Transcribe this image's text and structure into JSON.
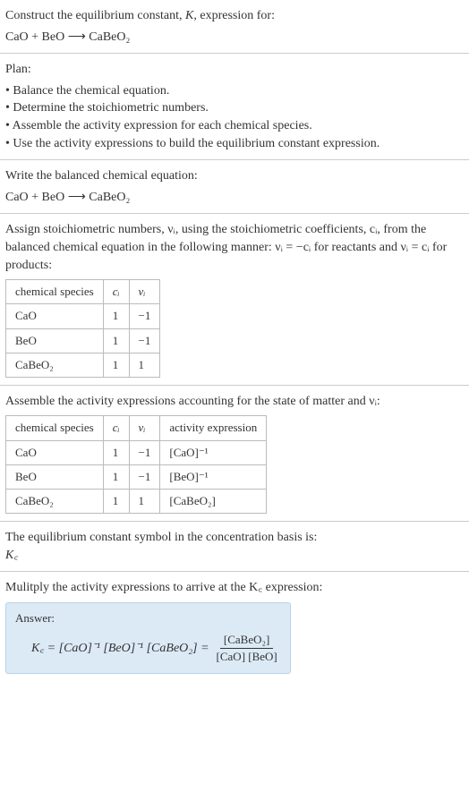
{
  "intro": {
    "line1": "Construct the equilibrium constant, K, expression for:",
    "equation": "CaO + BeO ⟶ CaBeO₂"
  },
  "plan": {
    "heading": "Plan:",
    "items": [
      "Balance the chemical equation.",
      "Determine the stoichiometric numbers.",
      "Assemble the activity expression for each chemical species.",
      "Use the activity expressions to build the equilibrium constant expression."
    ]
  },
  "balanced": {
    "heading": "Write the balanced chemical equation:",
    "equation": "CaO + BeO ⟶ CaBeO₂"
  },
  "stoich": {
    "text_a": "Assign stoichiometric numbers, νᵢ, using the stoichiometric coefficients, cᵢ, from the balanced chemical equation in the following manner: νᵢ = −cᵢ for reactants and νᵢ = cᵢ for products:",
    "headers": {
      "species": "chemical species",
      "ci": "cᵢ",
      "vi": "νᵢ"
    },
    "rows": [
      {
        "species": "CaO",
        "ci": "1",
        "vi": "−1"
      },
      {
        "species": "BeO",
        "ci": "1",
        "vi": "−1"
      },
      {
        "species": "CaBeO₂",
        "ci": "1",
        "vi": "1"
      }
    ]
  },
  "activity": {
    "heading": "Assemble the activity expressions accounting for the state of matter and νᵢ:",
    "headers": {
      "species": "chemical species",
      "ci": "cᵢ",
      "vi": "νᵢ",
      "expr": "activity expression"
    },
    "rows": [
      {
        "species": "CaO",
        "ci": "1",
        "vi": "−1",
        "expr": "[CaO]⁻¹"
      },
      {
        "species": "BeO",
        "ci": "1",
        "vi": "−1",
        "expr": "[BeO]⁻¹"
      },
      {
        "species": "CaBeO₂",
        "ci": "1",
        "vi": "1",
        "expr": "[CaBeO₂]"
      }
    ]
  },
  "symbol_note": {
    "line": "The equilibrium constant symbol in the concentration basis is:",
    "sym": "K꜀"
  },
  "multiply": {
    "line": "Mulitply the activity expressions to arrive at the K꜀ expression:"
  },
  "answer": {
    "label": "Answer:",
    "lhs": "K꜀ = [CaO]⁻¹ [BeO]⁻¹ [CaBeO₂] =",
    "frac_num": "[CaBeO₂]",
    "frac_den": "[CaO] [BeO]"
  },
  "chart_data": {
    "type": "table",
    "tables": [
      {
        "title": "Stoichiometric numbers",
        "columns": [
          "chemical species",
          "cᵢ",
          "νᵢ"
        ],
        "rows": [
          [
            "CaO",
            1,
            -1
          ],
          [
            "BeO",
            1,
            -1
          ],
          [
            "CaBeO₂",
            1,
            1
          ]
        ]
      },
      {
        "title": "Activity expressions",
        "columns": [
          "chemical species",
          "cᵢ",
          "νᵢ",
          "activity expression"
        ],
        "rows": [
          [
            "CaO",
            1,
            -1,
            "[CaO]^-1"
          ],
          [
            "BeO",
            1,
            -1,
            "[BeO]^-1"
          ],
          [
            "CaBeO₂",
            1,
            1,
            "[CaBeO₂]"
          ]
        ]
      }
    ]
  }
}
